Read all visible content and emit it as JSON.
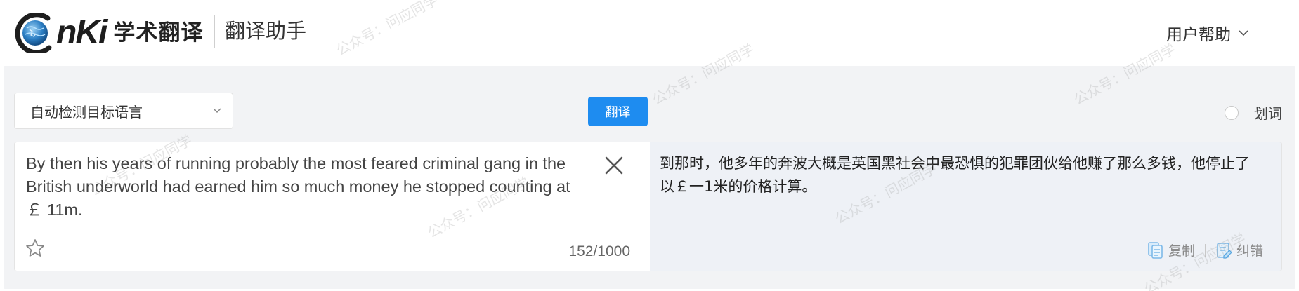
{
  "header": {
    "logo_text": "nKi",
    "logo_subtitle": "学术翻译",
    "page_title": "翻译助手",
    "help_label": "用户帮助"
  },
  "toolbar": {
    "language_select_value": "自动检测目标语言",
    "translate_label": "翻译",
    "word_lookup_label": "划词"
  },
  "source": {
    "text": "By then his years of running probably the most feared criminal gang in the British underworld had earned him so much money he stopped counting at ￡ 11m.",
    "char_count": "152/1000"
  },
  "target": {
    "text": "到那时，他多年的奔波大概是英国黑社会中最恐惧的犯罪团伙给他赚了那么多钱，他停止了以￡一1米的价格计算。",
    "copy_label": "复制",
    "correct_label": "纠错"
  },
  "watermark": {
    "text": "公众号：问应同学"
  },
  "colors": {
    "accent": "#1e8cf0",
    "panel_bg": "#f2f3f5",
    "target_bg": "#eef1f6"
  }
}
